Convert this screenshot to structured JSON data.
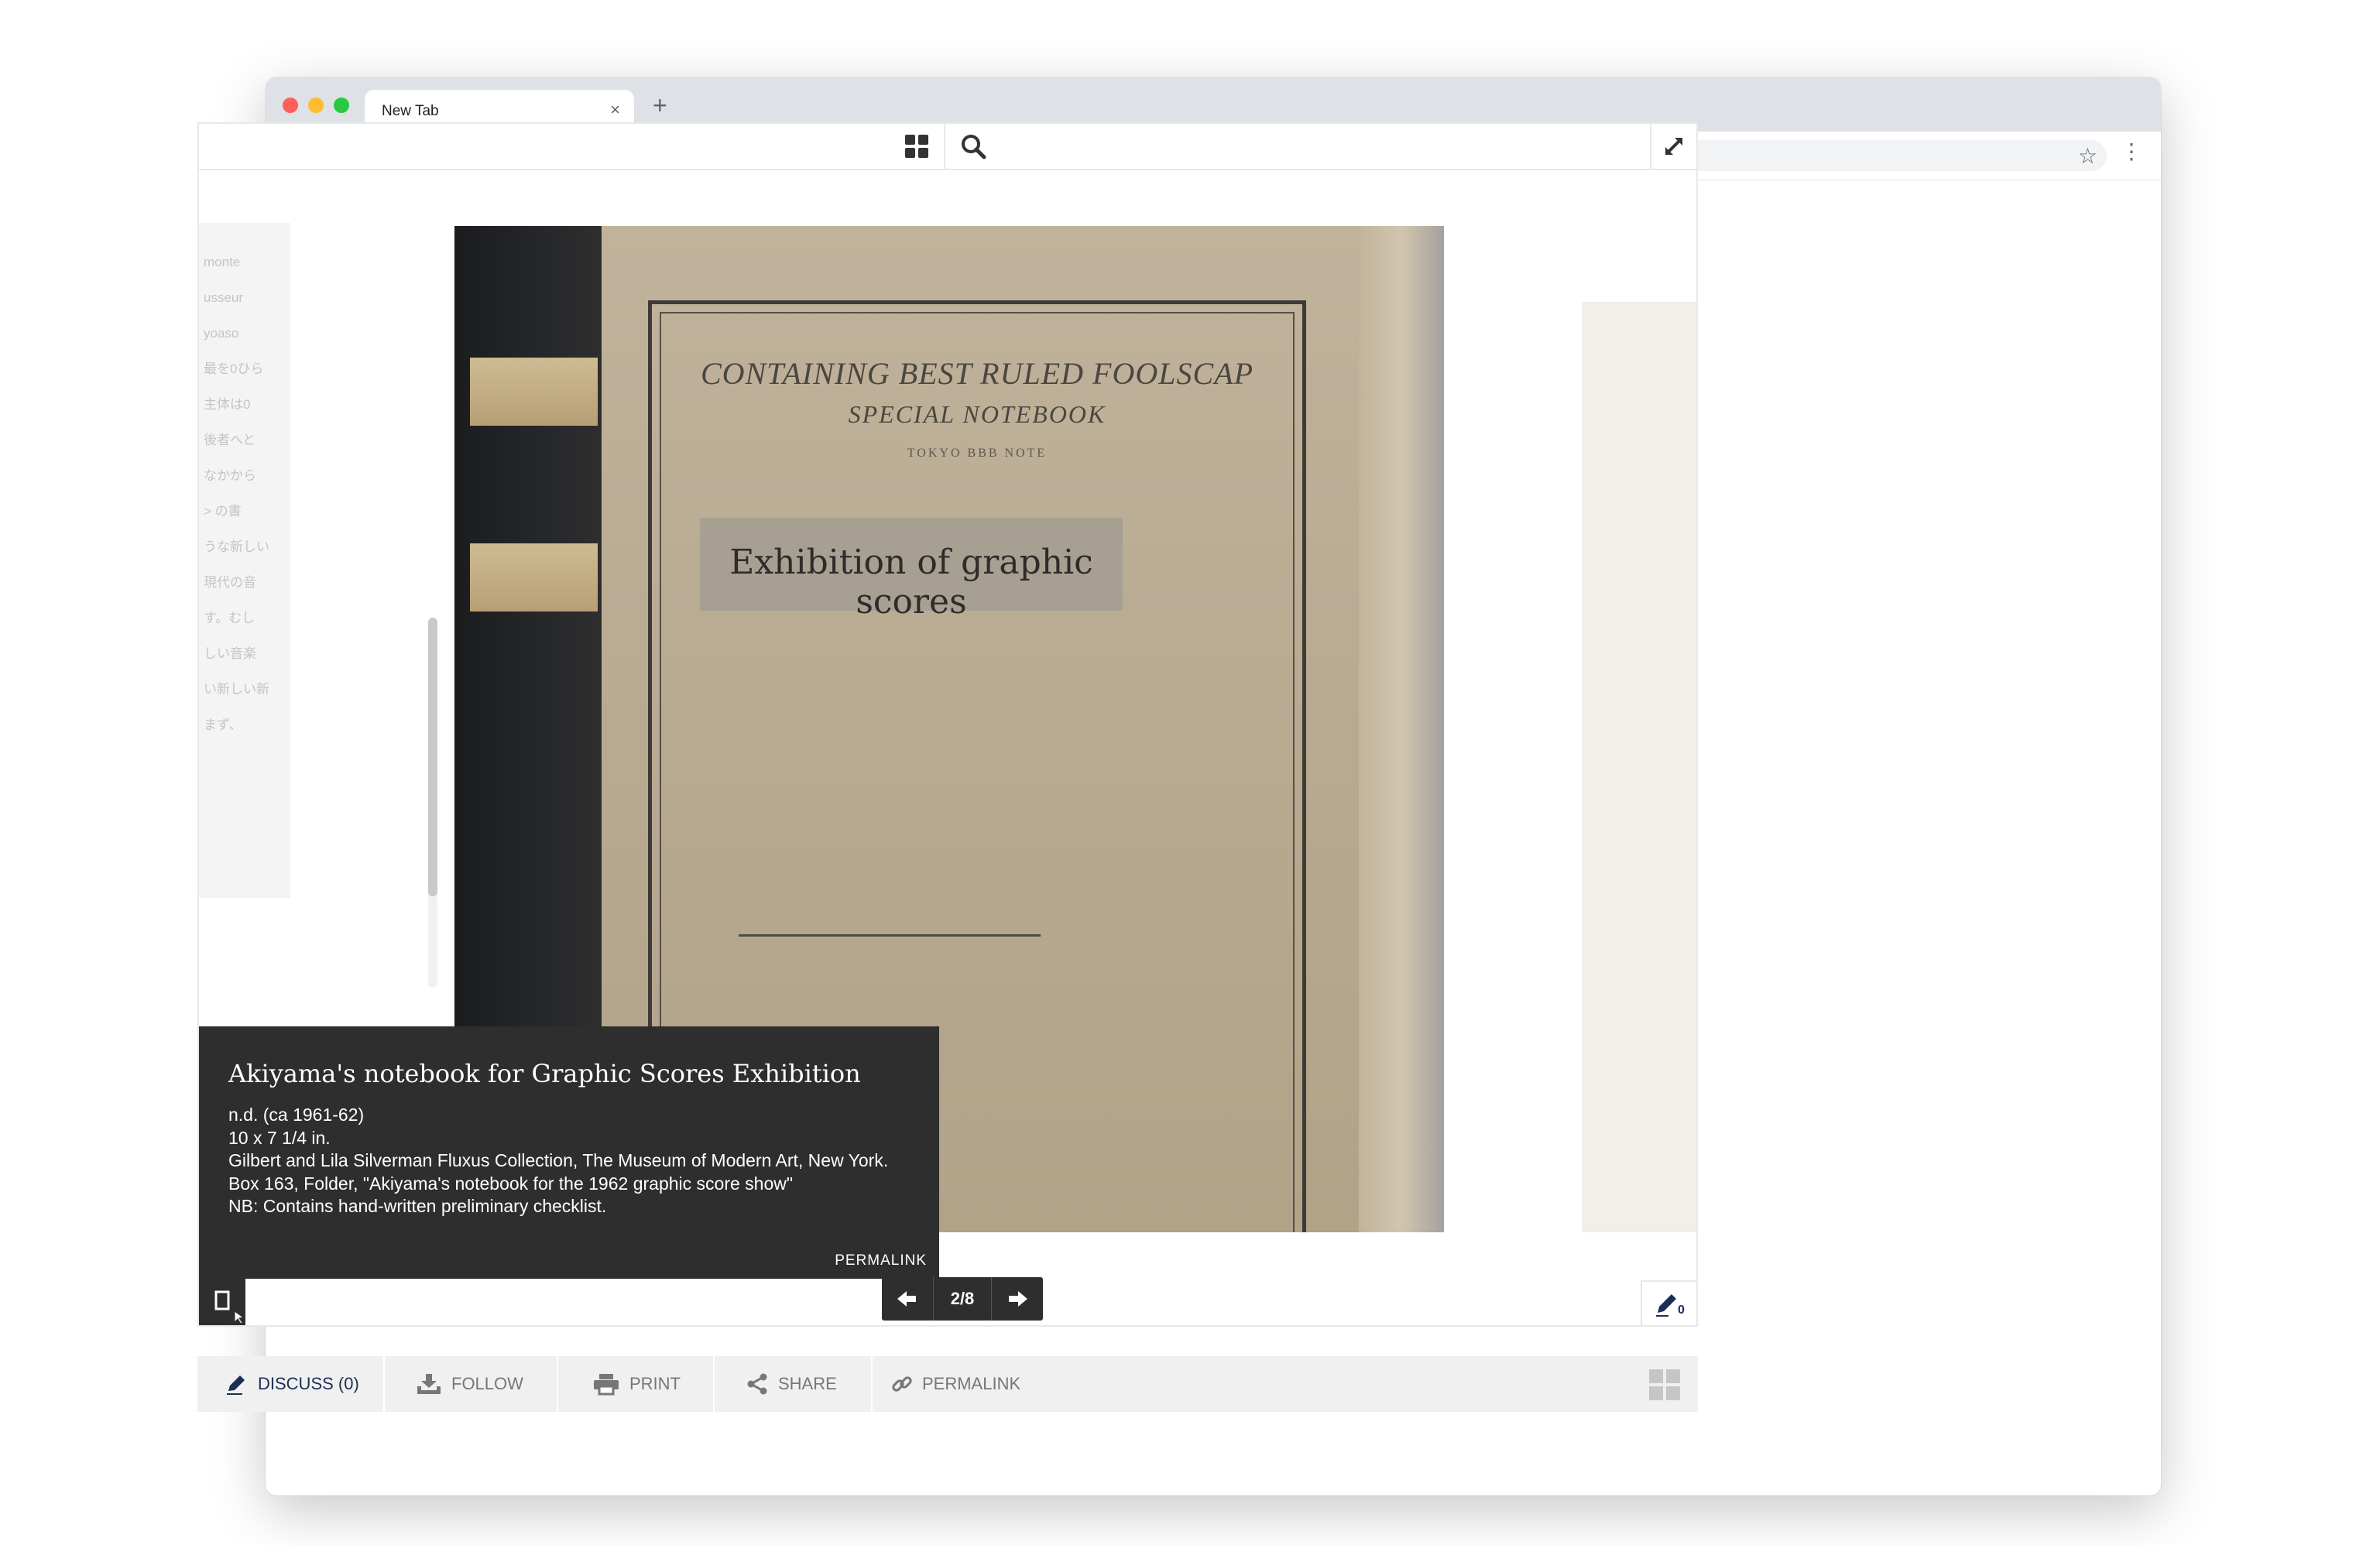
{
  "browser": {
    "tab_title": "New Tab",
    "tab_close": "×",
    "new_tab": "+",
    "back": "←",
    "forward": "→",
    "reload": "↻",
    "star": "☆",
    "menu": "⋮",
    "url": ""
  },
  "page": {
    "left_page_text": [
      "monte",
      "usseur",
      "yoaso",
      "最を0ひら",
      "主体は0",
      "後者へと",
      "なかから",
      "> の書",
      "うな新しい",
      "現代の音",
      "す。むし",
      "しい音楽",
      "い新しい新",
      "まず、"
    ],
    "cover": {
      "line1": "CONTAINING BEST RULED FOOLSCAP",
      "line2": "SPECIAL NOTEBOOK",
      "line3": "TOKYO BBB NOTE",
      "label": "Exhibition of graphic scores"
    },
    "caption": {
      "title": "Akiyama's notebook for Graphic Scores Exhibition",
      "lines": [
        "n.d. (ca 1961-62)",
        "10 x 7 1/4 in.",
        "Gilbert and Lila Silverman Fluxus Collection, The Museum of Modern Art, New York.",
        "Box 163, Folder, \"Akiyama's notebook for the 1962 graphic score show\"",
        "NB: Contains hand-written preliminary checklist."
      ],
      "permalink": "PERMALINK"
    },
    "pager": {
      "current": "2/8"
    },
    "annotation_count": "0"
  },
  "actions": {
    "discuss": "DISCUSS (0)",
    "follow": "FOLLOW",
    "print": "PRINT",
    "share": "SHARE",
    "permalink": "PERMALINK"
  },
  "icons": {
    "grid": "grid-icon",
    "search": "search-icon",
    "fullscreen": "expand-icon",
    "prev": "arrow-left-icon",
    "next": "arrow-right-icon",
    "page_toggle": "single-page-icon",
    "annotate": "pencil-icon",
    "follow": "download-tray-icon",
    "print": "printer-icon",
    "share": "share-icon",
    "permalink": "link-icon",
    "layout": "grid-layout-icon"
  },
  "colors": {
    "caption_bg": "#2e2e2e",
    "action_bar_bg": "#f0f0f0",
    "discuss_active": "#1d2e55",
    "photo_tan": "#b9ab92"
  }
}
